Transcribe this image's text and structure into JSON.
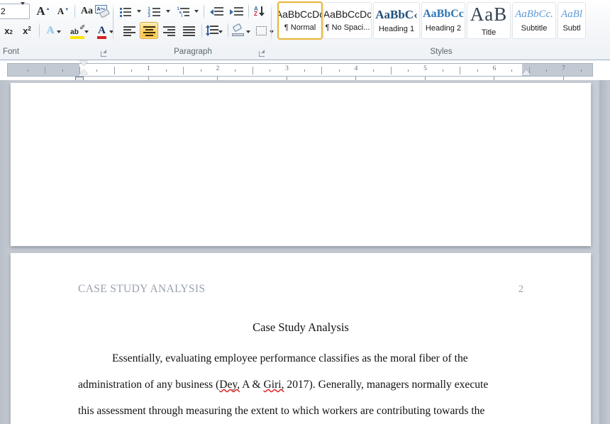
{
  "ribbon": {
    "groups": [
      {
        "name": "font",
        "label": "Font"
      },
      {
        "name": "paragraph",
        "label": "Paragraph"
      },
      {
        "name": "styles",
        "label": "Styles"
      }
    ],
    "font_group": {
      "font_size_value": "2",
      "font_size_caret": "▾",
      "buttons": [
        {
          "name": "grow-font",
          "glyph": "A",
          "sup": "▲"
        },
        {
          "name": "shrink-font",
          "glyph": "A",
          "sup": "▼"
        },
        {
          "name": "change-case",
          "glyph": "Aa"
        },
        {
          "name": "clear-formatting",
          "glyph": "Aa"
        },
        {
          "name": "subscript",
          "glyph": "x",
          "sub": "2"
        },
        {
          "name": "superscript",
          "glyph": "x",
          "sup": "2"
        },
        {
          "name": "text-effects",
          "glyph": "A"
        },
        {
          "name": "text-highlight-color",
          "glyph": "ab"
        },
        {
          "name": "font-color",
          "glyph": "A"
        }
      ]
    },
    "paragraph_group": {
      "buttons": [
        {
          "name": "bullets"
        },
        {
          "name": "numbering"
        },
        {
          "name": "multilevel-list"
        },
        {
          "name": "decrease-indent"
        },
        {
          "name": "increase-indent"
        },
        {
          "name": "sort"
        },
        {
          "name": "show-formatting-marks",
          "glyph": "¶"
        },
        {
          "name": "align-left"
        },
        {
          "name": "align-center",
          "active": true
        },
        {
          "name": "align-right"
        },
        {
          "name": "justify"
        },
        {
          "name": "line-spacing"
        },
        {
          "name": "shading"
        },
        {
          "name": "borders"
        }
      ]
    },
    "styles_group": {
      "items": [
        {
          "preview": "AaBbCcDc",
          "label": "¶ Normal",
          "selected": true,
          "style": "normal"
        },
        {
          "preview": "AaBbCcDc",
          "label": "¶ No Spaci...",
          "selected": false,
          "style": "normal"
        },
        {
          "preview": "AaBbC‹",
          "label": "Heading 1",
          "selected": false,
          "style": "heading1"
        },
        {
          "preview": "AaBbCc",
          "label": "Heading 2",
          "selected": false,
          "style": "heading2"
        },
        {
          "preview": "AaB",
          "label": "Title",
          "selected": false,
          "style": "title"
        },
        {
          "preview": "AaBbCc.",
          "label": "Subtitle",
          "selected": false,
          "style": "subtitle"
        },
        {
          "preview": "AaBl",
          "label": "Subtl",
          "selected": false,
          "style": "subtitle"
        }
      ]
    }
  },
  "ruler": {
    "numbers": [
      "1",
      "2",
      "3",
      "4",
      "5",
      "6",
      "7"
    ],
    "left_indent_inches": 0.0,
    "right_indent_inches": 6.5,
    "unit": "inches"
  },
  "document": {
    "header_text": "CASE STUDY ANALYSIS",
    "page_number": "2",
    "title": "Case Study Analysis",
    "paragraph_lines": [
      "Essentially, evaluating employee performance classifies as the moral fiber of the",
      "administration of any business (Dey, A & Giri, 2017). Generally, managers normally execute",
      "this assessment through measuring the extent to which workers are contributing towards the"
    ],
    "misspelled_words": [
      "Dey",
      "Giri"
    ],
    "line2_segments": [
      {
        "text": "administration of any business (",
        "misspelled": false
      },
      {
        "text": "Dey,",
        "misspelled": true
      },
      {
        "text": " A & ",
        "misspelled": false
      },
      {
        "text": "Giri,",
        "misspelled": true
      },
      {
        "text": " 2017). Generally, managers normally execute",
        "misspelled": false
      }
    ]
  },
  "colors": {
    "ribbon_bg": "#eef1f5",
    "group_label": "#5a6670",
    "selected_style_border": "#e8b53a",
    "active_button": "#fdc13f",
    "canvas_bg": "#c6ccd4",
    "page_bg": "#ffffff",
    "header_gray": "#9aa1ab",
    "body_text": "#121212",
    "spellcheck_underline": "#e02b2b",
    "ruler_number": "#5c7187",
    "heading_blue": "#1f4e79"
  }
}
